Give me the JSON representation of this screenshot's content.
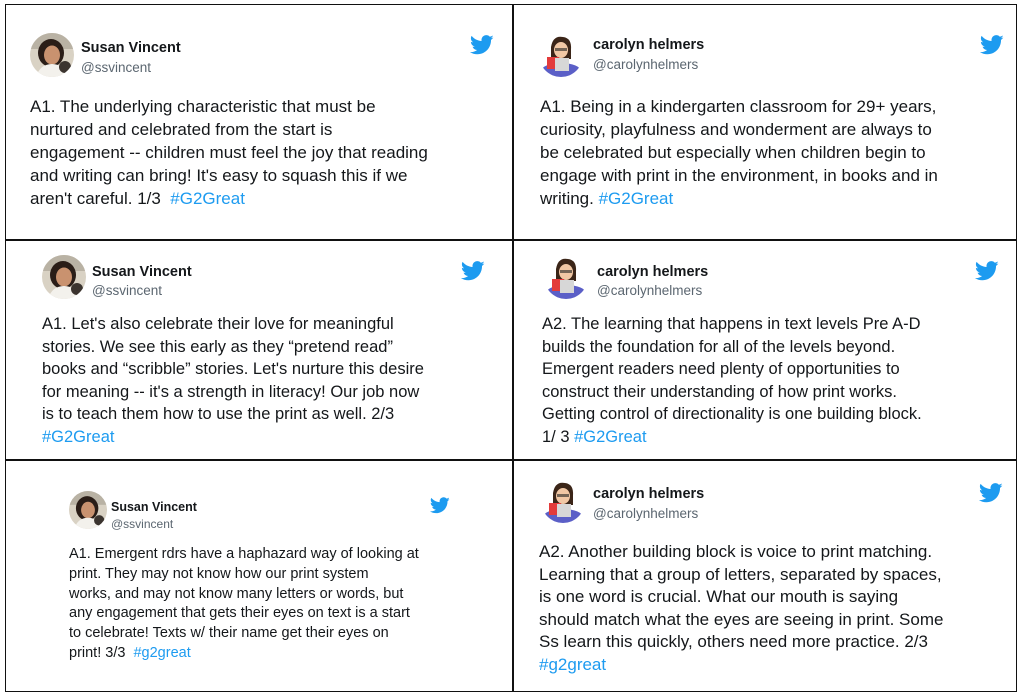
{
  "colors": {
    "twitter_blue": "#1d9bf0",
    "text": "#14171a",
    "muted": "#5b6670",
    "border": "#111111"
  },
  "tweets": [
    {
      "name": "Susan Vincent",
      "handle": "@ssvincent",
      "avatar": "susan-photo",
      "lines": [
        "A1.  The underlying characteristic that must be",
        "nurtured and celebrated from the start is",
        "engagement -- children must feel the joy that reading",
        "and writing can bring! It's easy to squash this if we",
        "aren't careful. 1/3  "
      ],
      "hashtag": "#G2Great"
    },
    {
      "name": "carolyn helmers",
      "handle": "@carolynhelmers",
      "avatar": "carolyn-bitmoji",
      "lines": [
        "A1. Being in a kindergarten classroom for 29+ years,",
        "curiosity, playfulness and wonderment are always to",
        "be celebrated but especially when children begin to",
        "engage with print in the environment, in books and in",
        "writing. "
      ],
      "hashtag": "#G2Great"
    },
    {
      "name": "Susan Vincent",
      "handle": "@ssvincent",
      "avatar": "susan-photo",
      "lines": [
        "A1. Let's also celebrate their love for meaningful",
        "stories. We see this early as they “pretend read”",
        "books and “scribble” stories. Let's nurture this desire",
        "for meaning -- it's a strength in literacy! Our job now",
        "is to teach them how to use the print as well. 2/3",
        ""
      ],
      "hashtag": "#G2Great"
    },
    {
      "name": "carolyn helmers",
      "handle": "@carolynhelmers",
      "avatar": "carolyn-bitmoji",
      "lines": [
        "A2. The learning that happens in text levels Pre A-D",
        "builds the foundation for all of the levels beyond.",
        "Emergent readers need plenty of opportunities to",
        "construct their understanding of how print works.",
        "Getting control of directionality is one building block.",
        "1/ 3 "
      ],
      "hashtag": "#G2Great"
    },
    {
      "name": "Susan Vincent",
      "handle": "@ssvincent",
      "avatar": "susan-photo",
      "lines": [
        "A1. Emergent rdrs have a haphazard way of looking at",
        "print. They may not know how our print system",
        "works, and may not know many letters or words, but",
        "any engagement that gets their eyes on text is a start",
        "to celebrate! Texts w/ their name get their eyes on",
        "print! 3/3  "
      ],
      "hashtag": "#g2great"
    },
    {
      "name": "carolyn helmers",
      "handle": "@carolynhelmers",
      "avatar": "carolyn-bitmoji",
      "lines": [
        "A2. Another building block is voice to print matching.",
        "Learning that a group of letters, separated by spaces,",
        "is one word is crucial. What our mouth is saying",
        "should match what the eyes are seeing in print. Some",
        "Ss learn this quickly, others need more practice. 2/3",
        ""
      ],
      "hashtag": "#g2great"
    }
  ]
}
